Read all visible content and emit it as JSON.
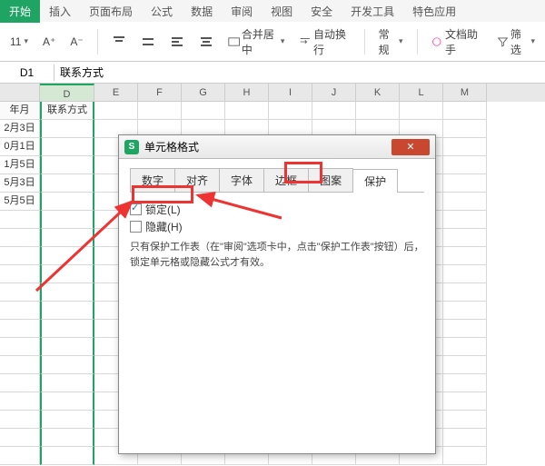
{
  "ribbon": {
    "tabs": [
      "开始",
      "插入",
      "页面布局",
      "公式",
      "数据",
      "审阅",
      "视图",
      "安全",
      "开发工具",
      "特色应用"
    ],
    "active": "开始"
  },
  "toolbar": {
    "font_size": "11",
    "a_plus": "A⁺",
    "a_minus": "A⁻",
    "merge_center": "合并居中",
    "wrap_text": "自动换行",
    "number_format": "常规",
    "doc_assist": "文档助手",
    "filter": "筛选"
  },
  "formula_bar": {
    "name_box": "D1",
    "value": "联系方式"
  },
  "columns": [
    "",
    "D",
    "E",
    "F",
    "G",
    "H",
    "I",
    "J",
    "K",
    "L",
    "M"
  ],
  "rows": [
    [
      "年月",
      "联系方式"
    ],
    [
      "2月3日",
      ""
    ],
    [
      "0月1日",
      ""
    ],
    [
      "1月5日",
      ""
    ],
    [
      "5月3日",
      ""
    ],
    [
      "5月5日",
      ""
    ]
  ],
  "dialog": {
    "title": "单元格格式",
    "tabs": [
      "数字",
      "对齐",
      "字体",
      "边框",
      "图案",
      "保护"
    ],
    "active_tab": "保护",
    "lock_label": "锁定(L)",
    "hide_label": "隐藏(H)",
    "help_text": "只有保护工作表（在\"审阅\"选项卡中，点击\"保护工作表\"按钮）后，锁定单元格或隐藏公式才有效。",
    "close": "✕"
  }
}
